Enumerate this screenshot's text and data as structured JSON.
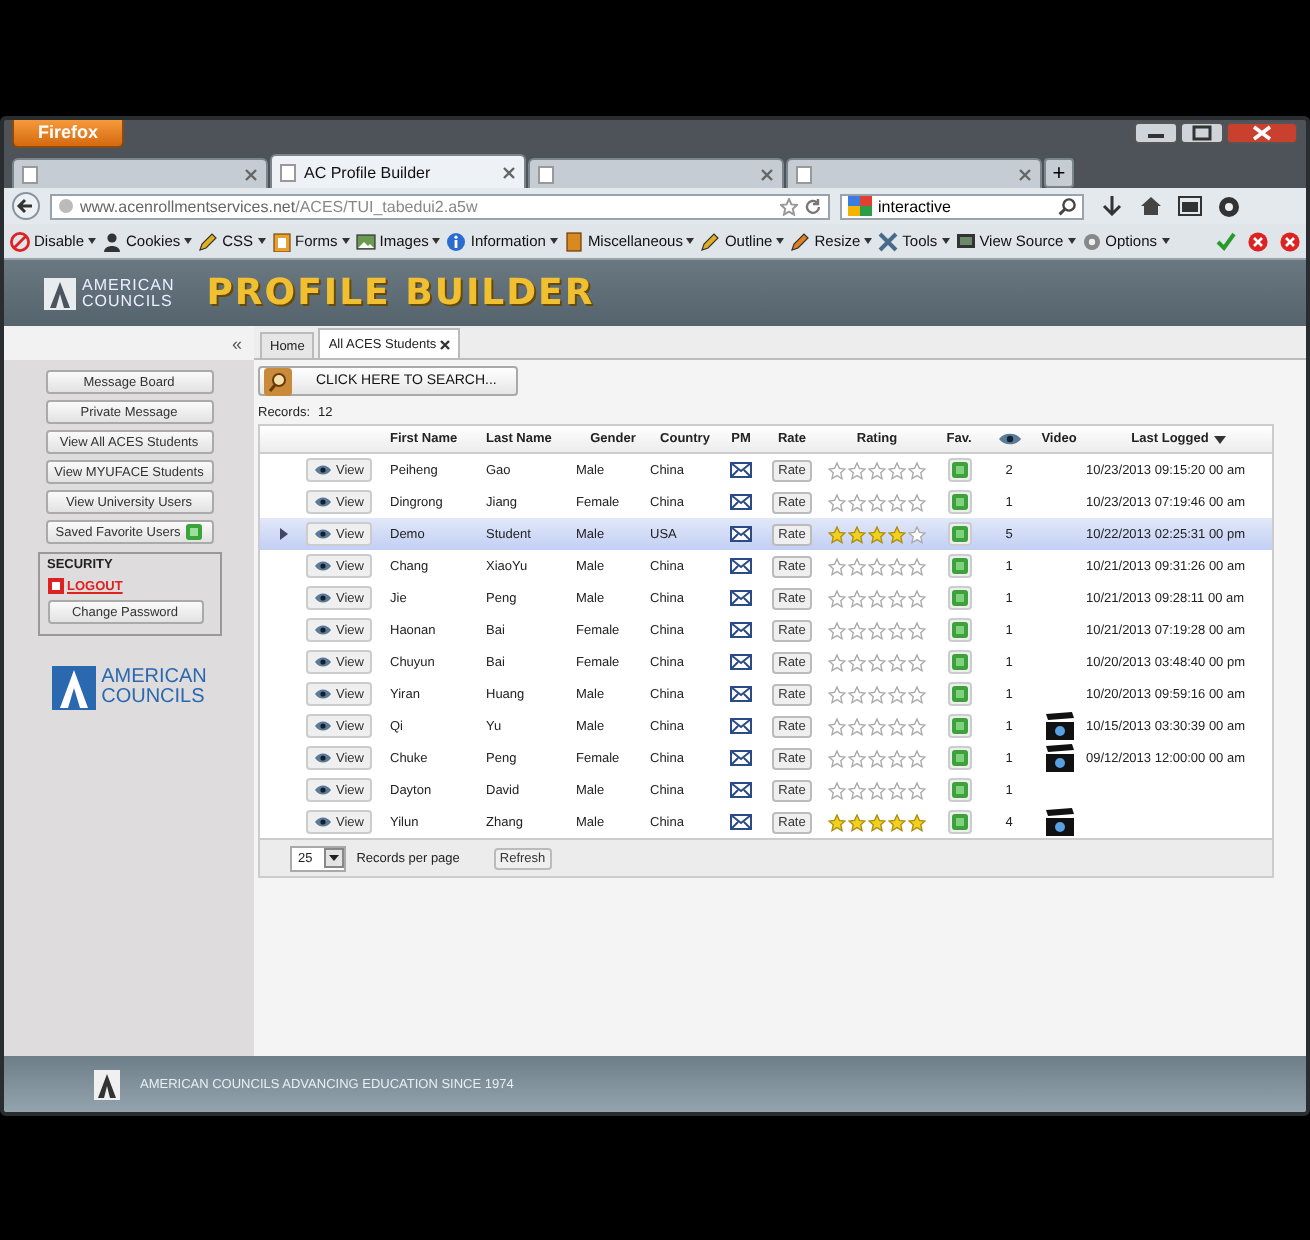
{
  "browser": {
    "menu_button": "Firefox",
    "tabs": [
      {
        "selected": false
      },
      {
        "title": "AC Profile Builder",
        "selected": true
      },
      {
        "selected": false
      },
      {
        "selected": false
      }
    ],
    "new_tab": "+",
    "url_host": "www.acenrollmentservices.net",
    "url_path": "/ACES/TUI_tabedui2.a5w",
    "search_value": "interactive",
    "toolbar": [
      "Disable",
      "Cookies",
      "CSS",
      "Forms",
      "Images",
      "Information",
      "Miscellaneous",
      "Outline",
      "Resize",
      "Tools",
      "View Source",
      "Options"
    ]
  },
  "header": {
    "logo_top": "AMERICAN",
    "logo_bottom": "COUNCILS",
    "title": "PROFILE BUILDER"
  },
  "sidebar": {
    "collapse": "«",
    "buttons": [
      {
        "label": "Message Board"
      },
      {
        "label": "Private Message"
      },
      {
        "label": "View All ACES Students"
      },
      {
        "label": "View MYUFACE Students"
      },
      {
        "label": "View University Users"
      },
      {
        "label": "Saved Favorite Users",
        "badge": true
      }
    ],
    "security": {
      "title": "SECURITY",
      "logout": "LOGOUT",
      "change_password": "Change Password"
    },
    "logo_top": "AMERICAN",
    "logo_bottom": "COUNCILS"
  },
  "tabs": [
    {
      "label": "Home",
      "selected": false
    },
    {
      "label": "All ACES Students",
      "selected": true
    }
  ],
  "search_button": "CLICK HERE TO SEARCH...",
  "records_label": "Records:",
  "records_count": "12",
  "columns": [
    {
      "kind": "text",
      "label": "First Name"
    },
    {
      "kind": "text",
      "label": "Last Name"
    },
    {
      "kind": "text",
      "label": "Gender"
    },
    {
      "kind": "text",
      "label": "Country"
    },
    {
      "kind": "text",
      "label": "PM"
    },
    {
      "kind": "text",
      "label": "Rate"
    },
    {
      "kind": "text",
      "label": "Rating"
    },
    {
      "kind": "text",
      "label": "Fav."
    },
    {
      "kind": "icon"
    },
    {
      "kind": "text",
      "label": "Video"
    },
    {
      "kind": "sorted",
      "label": "Last Logged"
    }
  ],
  "rows": [
    {
      "view": "View",
      "first": "Peiheng",
      "last": "Gao",
      "gender": "Male",
      "country": "China",
      "rate": "Rate",
      "stars": 0,
      "views": "2",
      "video": false,
      "last_logged": "10/23/2013 09:15:20 00 am",
      "selected": false
    },
    {
      "view": "View",
      "first": "Dingrong",
      "last": "Jiang",
      "gender": "Female",
      "country": "China",
      "rate": "Rate",
      "stars": 0,
      "views": "1",
      "video": false,
      "last_logged": "10/23/2013 07:19:46 00 am",
      "selected": false
    },
    {
      "view": "View",
      "first": "Demo",
      "last": "Student",
      "gender": "Male",
      "country": "USA",
      "rate": "Rate",
      "stars": 4,
      "views": "5",
      "video": false,
      "last_logged": "10/22/2013 02:25:31 00 pm",
      "selected": true
    },
    {
      "view": "View",
      "first": "Chang",
      "last": "XiaoYu",
      "gender": "Male",
      "country": "China",
      "rate": "Rate",
      "stars": 0,
      "views": "1",
      "video": false,
      "last_logged": "10/21/2013 09:31:26 00 am",
      "selected": false
    },
    {
      "view": "View",
      "first": "Jie",
      "last": "Peng",
      "gender": "Male",
      "country": "China",
      "rate": "Rate",
      "stars": 0,
      "views": "1",
      "video": false,
      "last_logged": "10/21/2013 09:28:11 00 am",
      "selected": false
    },
    {
      "view": "View",
      "first": "Haonan",
      "last": "Bai",
      "gender": "Female",
      "country": "China",
      "rate": "Rate",
      "stars": 0,
      "views": "1",
      "video": false,
      "last_logged": "10/21/2013 07:19:28 00 am",
      "selected": false
    },
    {
      "view": "View",
      "first": "Chuyun",
      "last": "Bai",
      "gender": "Female",
      "country": "China",
      "rate": "Rate",
      "stars": 0,
      "views": "1",
      "video": false,
      "last_logged": "10/20/2013 03:48:40 00 pm",
      "selected": false
    },
    {
      "view": "View",
      "first": "Yiran",
      "last": "Huang",
      "gender": "Male",
      "country": "China",
      "rate": "Rate",
      "stars": 0,
      "views": "1",
      "video": false,
      "last_logged": "10/20/2013 09:59:16 00 am",
      "selected": false
    },
    {
      "view": "View",
      "first": "Qi",
      "last": "Yu",
      "gender": "Male",
      "country": "China",
      "rate": "Rate",
      "stars": 0,
      "views": "1",
      "video": true,
      "last_logged": "10/15/2013 03:30:39 00 am",
      "selected": false
    },
    {
      "view": "View",
      "first": "Chuke",
      "last": "Peng",
      "gender": "Female",
      "country": "China",
      "rate": "Rate",
      "stars": 0,
      "views": "1",
      "video": true,
      "last_logged": "09/12/2013 12:00:00 00 am",
      "selected": false
    },
    {
      "view": "View",
      "first": "Dayton",
      "last": "David",
      "gender": "Male",
      "country": "China",
      "rate": "Rate",
      "stars": 0,
      "views": "1",
      "video": false,
      "selected": false
    },
    {
      "view": "View",
      "first": "Yilun",
      "last": "Zhang",
      "gender": "Male",
      "country": "China",
      "rate": "Rate",
      "stars": 5,
      "views": "4",
      "video": true,
      "selected": false
    }
  ],
  "pager": {
    "page_size": "25",
    "label": "Records per page",
    "refresh": "Refresh"
  },
  "footer": {
    "text": "AMERICAN COUNCILS ADVANCING EDUCATION SINCE 1974"
  }
}
